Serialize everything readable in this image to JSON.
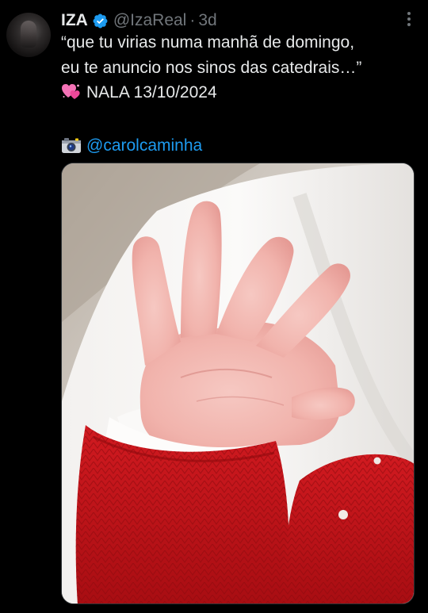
{
  "author": {
    "display_name": "IZA",
    "verified": true,
    "handle": "@IzaReal",
    "separator": "·",
    "time": "3d"
  },
  "tweet": {
    "line1": "“que tu virias numa manhã de domingo,",
    "line2": "eu te anuncio nos sinos das catedrais…”",
    "line3_emoji": "heart-emoji",
    "line3_text": "NALA 13/10/2024",
    "line4_emoji": "camera-emoji",
    "mention": "@carolcaminha"
  },
  "colors": {
    "background": "#000000",
    "text": "#e7e9ea",
    "muted": "#71767b",
    "link": "#1d9bf0",
    "verified": "#1d9bf0",
    "sweater_red": "#c8141a"
  },
  "icons": {
    "verified": "verified-badge-icon",
    "more": "more-options-icon"
  }
}
